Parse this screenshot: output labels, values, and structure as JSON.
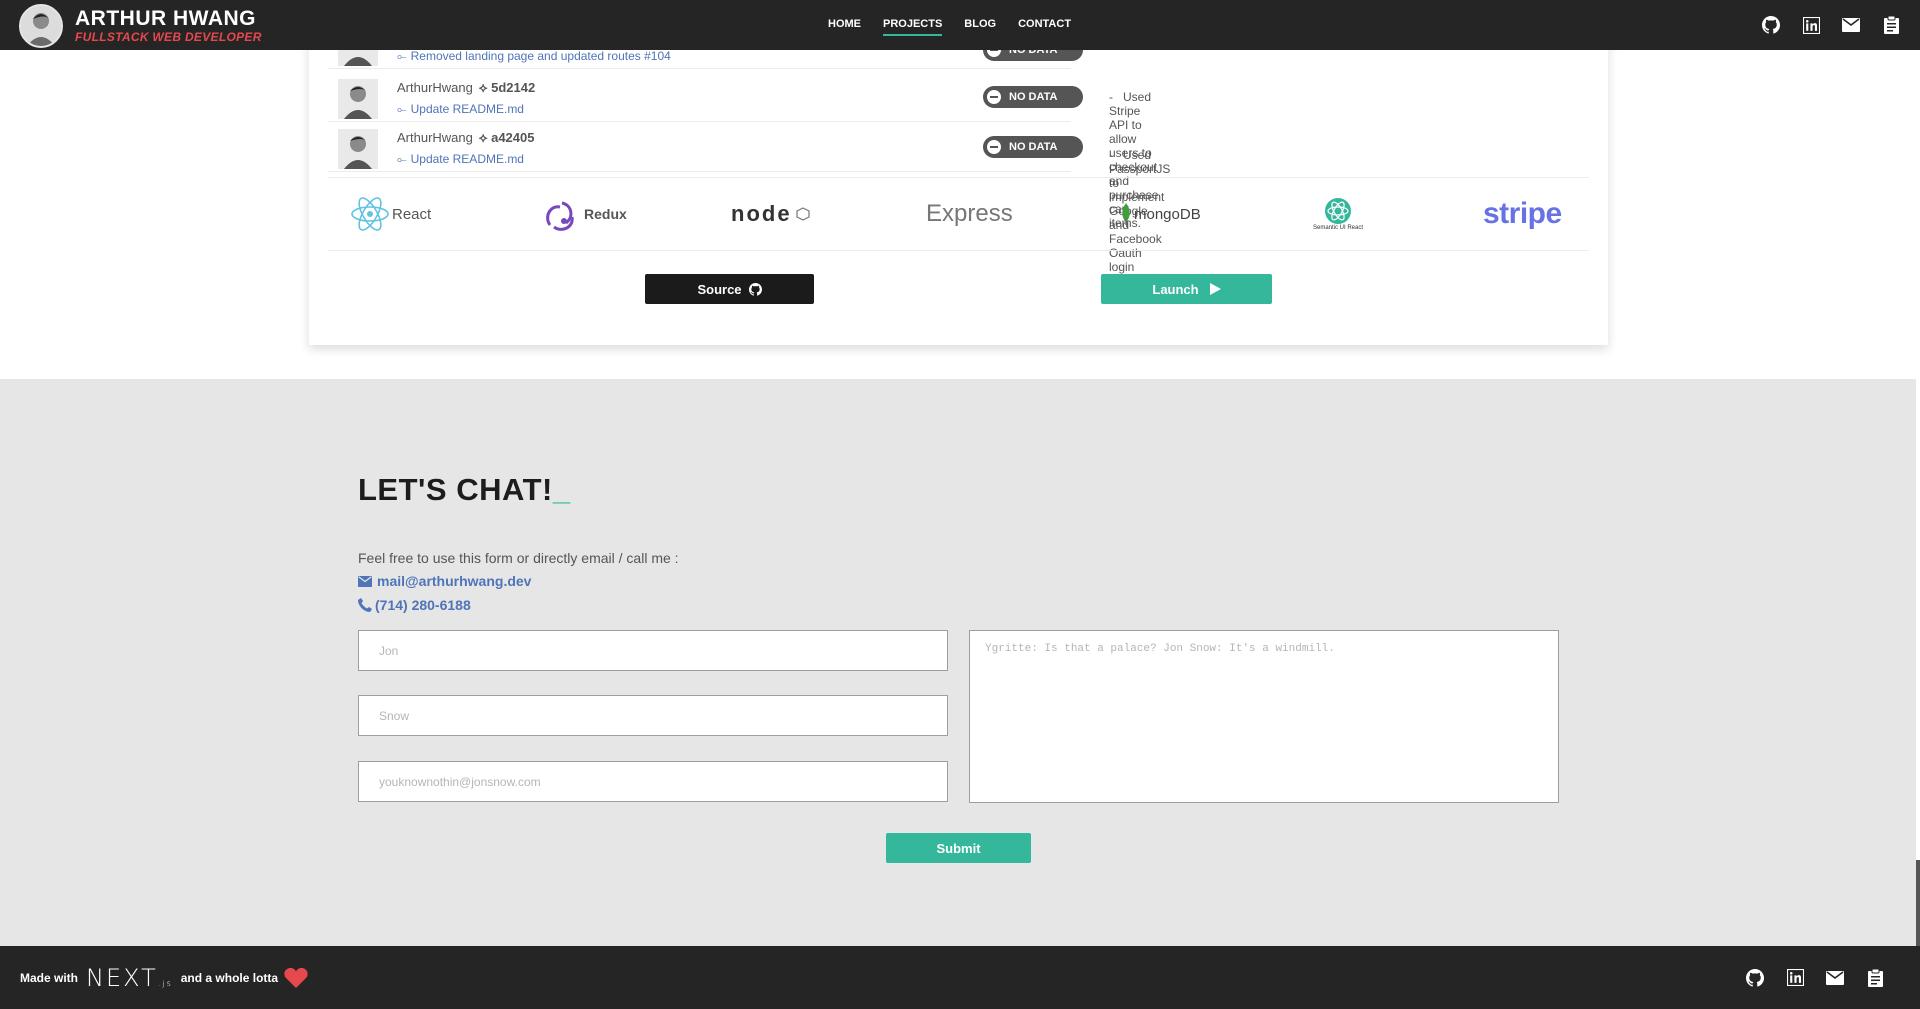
{
  "header": {
    "name": "ARTHUR HWANG",
    "subtitle": "FULLSTACK WEB DEVELOPER",
    "nav": [
      {
        "label": "HOME",
        "active": false
      },
      {
        "label": "PROJECTS",
        "active": true
      },
      {
        "label": "BLOG",
        "active": false
      },
      {
        "label": "CONTACT",
        "active": false
      }
    ],
    "social_icons": [
      "github-icon",
      "linkedin-icon",
      "mail-icon",
      "clipboard-icon"
    ]
  },
  "project": {
    "commits": [
      {
        "author": "",
        "sha": "",
        "message": "Removed landing page and updated routes #104",
        "status": "NO DATA"
      },
      {
        "author": "ArthurHwang",
        "sha": "5d2142",
        "message": "Update README.md",
        "status": "NO DATA"
      },
      {
        "author": "ArthurHwang",
        "sha": "a42405",
        "message": "Update README.md",
        "status": "NO DATA"
      }
    ],
    "bullets": [
      "Used Stripe API to allow users to checkout and purchase cart items.",
      "Used PassportJS to implement Google and Facebook Oauth login systems."
    ],
    "techs": [
      {
        "name": "React"
      },
      {
        "name": "Redux"
      },
      {
        "name": "node"
      },
      {
        "name": "Express"
      },
      {
        "name": "mongoDB"
      },
      {
        "name": "Semantic UI React"
      },
      {
        "name": "stripe"
      }
    ],
    "source_label": "Source",
    "launch_label": "Launch"
  },
  "contact": {
    "title": "LET'S CHAT!",
    "cursor": "_",
    "intro": "Feel free to use this form or directly email / call me :",
    "email": "mail@arthurhwang.dev",
    "phone": "(714) 280-6188",
    "first_name_placeholder": "Jon",
    "last_name_placeholder": "Snow",
    "email_placeholder": "youknownothin@jonsnow.com",
    "message_placeholder": "Ygritte: Is that a palace? Jon Snow: It's a windmill.",
    "submit_label": "Submit"
  },
  "footer": {
    "made_with": "Made with",
    "framework": "NEXT",
    "framework_suffix": ".js",
    "and_text": "and a whole lotta"
  },
  "colors": {
    "accent": "#35b79b",
    "header_bg": "#252525",
    "link": "#4f74b8",
    "heart": "#e5484d"
  }
}
